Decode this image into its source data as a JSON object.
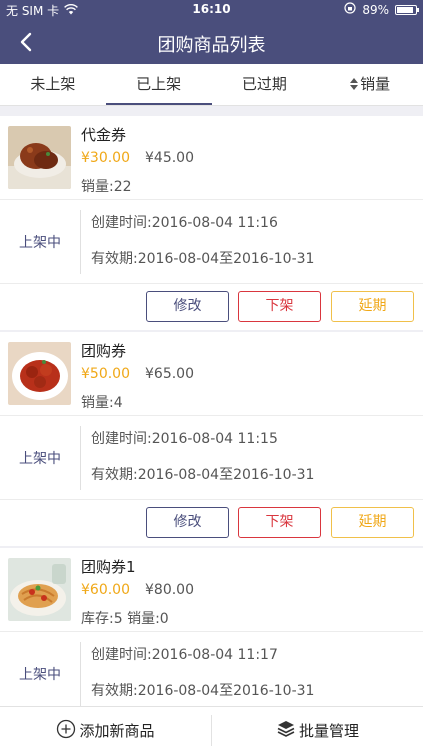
{
  "status_bar": {
    "carrier": "无 SIM 卡",
    "time": "16:10",
    "battery": "89%"
  },
  "nav": {
    "title": "团购商品列表"
  },
  "tabs": [
    {
      "label": "未上架",
      "active": false
    },
    {
      "label": "已上架",
      "active": true
    },
    {
      "label": "已过期",
      "active": false
    },
    {
      "label": "销量",
      "active": false
    }
  ],
  "items": [
    {
      "name": "代金券",
      "price": "¥30.00",
      "original_price": "¥45.00",
      "stock_sales": "销量:22",
      "status": "上架中",
      "created": "创建时间:2016-08-04 11:16",
      "validity": "有效期:2016-08-04至2016-10-31",
      "thumb": "meat-dish"
    },
    {
      "name": "团购券",
      "price": "¥50.00",
      "original_price": "¥65.00",
      "stock_sales": "销量:4",
      "status": "上架中",
      "created": "创建时间:2016-08-04 11:15",
      "validity": "有效期:2016-08-04至2016-10-31",
      "thumb": "braised-dish"
    },
    {
      "name": "团购券1",
      "price": "¥60.00",
      "original_price": "¥80.00",
      "stock_sales": "库存:5 销量:0",
      "status": "上架中",
      "created": "创建时间:2016-08-04 11:17",
      "validity": "有效期:2016-08-04至2016-10-31",
      "thumb": "pasta-dish"
    }
  ],
  "actions": {
    "edit": "修改",
    "take_down": "下架",
    "extend": "延期"
  },
  "bottom": {
    "add": "添加新商品",
    "batch": "批量管理"
  },
  "colors": {
    "primary": "#4a4e7c",
    "price": "#f0a818",
    "danger": "#d9363e",
    "warning": "#f0c04a"
  }
}
